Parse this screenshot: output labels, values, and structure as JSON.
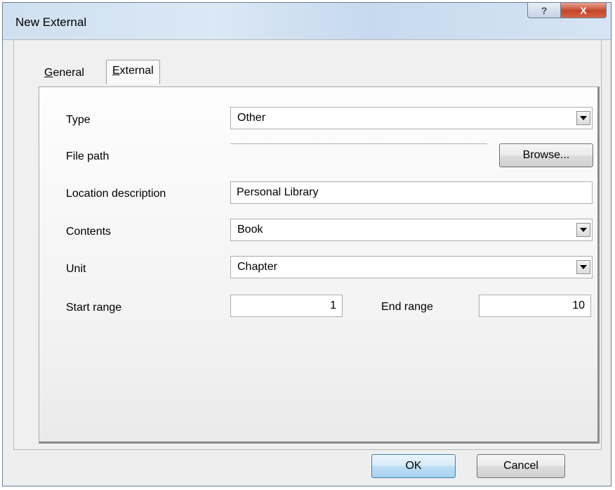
{
  "window": {
    "title": "New External",
    "help_symbol": "?",
    "close_symbol": "X"
  },
  "tabs": [
    {
      "label_prefix": "",
      "label_accel": "G",
      "label_rest": "eneral",
      "selected": false
    },
    {
      "label_prefix": "",
      "label_accel": "E",
      "label_rest": "xternal",
      "selected": true
    }
  ],
  "form": {
    "type_label": "Type",
    "type_value": "Other",
    "file_path_label": "File path",
    "browse_label": "Browse...",
    "location_label": "Location description",
    "location_value": "Personal Library",
    "contents_label": "Contents",
    "contents_value": "Book",
    "unit_label": "Unit",
    "unit_value": "Chapter",
    "start_label": "Start range",
    "start_value": "1",
    "end_label": "End range",
    "end_value": "10"
  },
  "buttons": {
    "ok_label": "OK",
    "cancel_label": "Cancel"
  },
  "icons": {
    "help": "help-icon",
    "close": "close-icon",
    "dropdown": "chevron-down-icon"
  }
}
